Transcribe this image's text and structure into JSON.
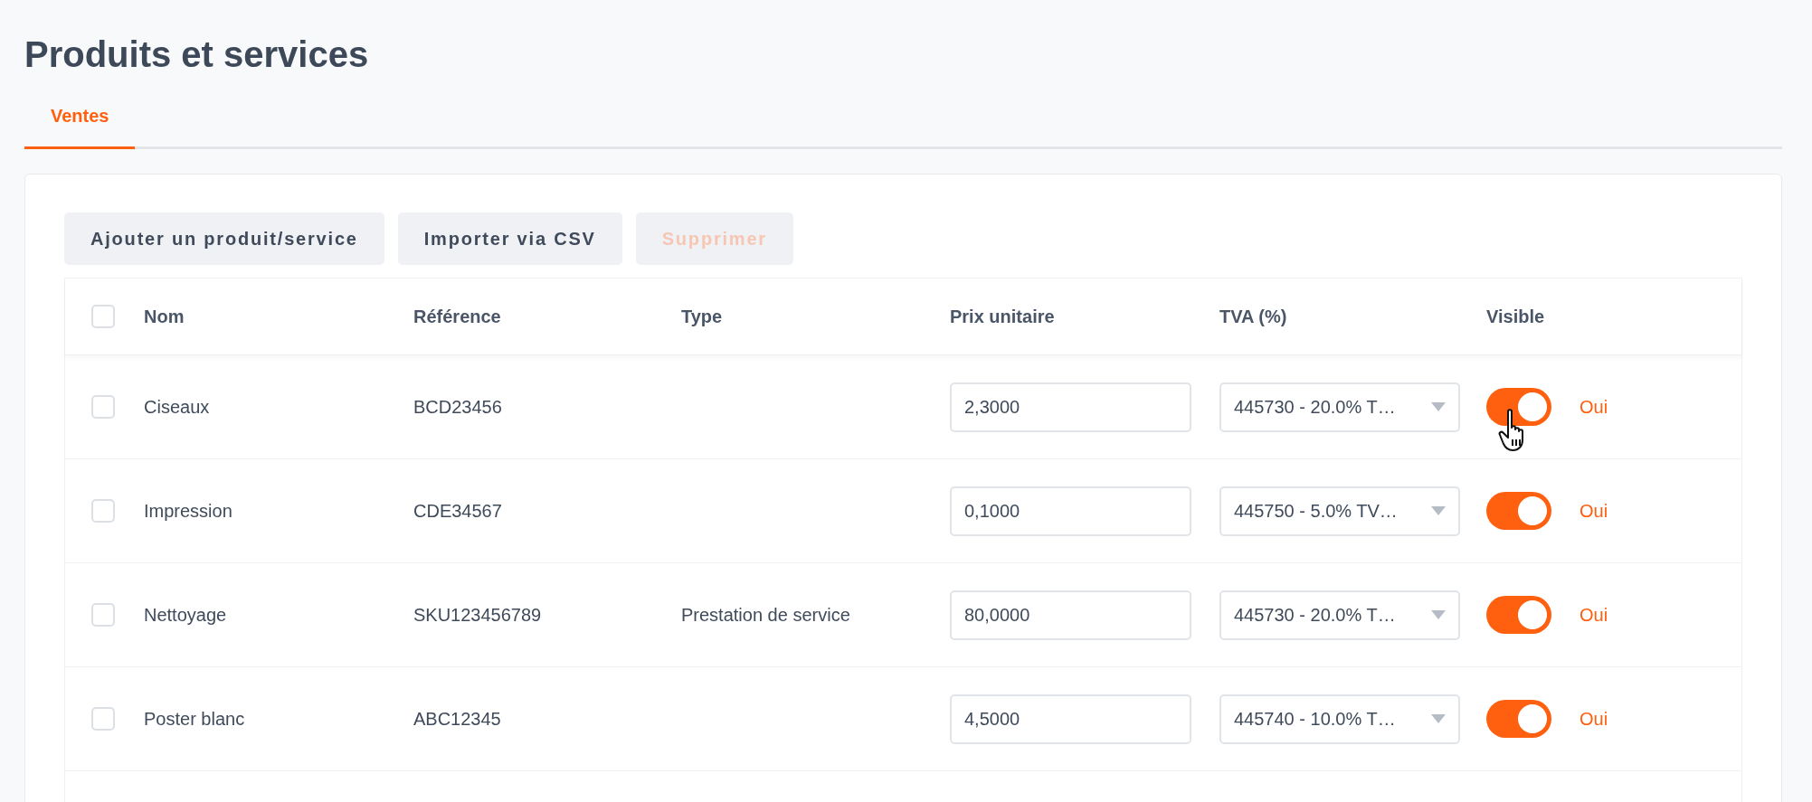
{
  "page": {
    "title": "Produits et services"
  },
  "tabs": [
    {
      "label": "Ventes",
      "selected": true
    }
  ],
  "toolbar": {
    "buttons": [
      {
        "label": "Ajouter un produit/service",
        "disabled": false
      },
      {
        "label": "Importer via CSV",
        "disabled": false
      },
      {
        "label": "Supprimer",
        "disabled": true
      }
    ]
  },
  "table": {
    "select_all": {
      "checked": false
    },
    "columns": [
      "Nom",
      "Référence",
      "Type",
      "Prix unitaire",
      "TVA (%)",
      "Visible"
    ],
    "rows": [
      {
        "checked": false,
        "name": "Ciseaux",
        "reference": "BCD23456",
        "type": "",
        "price": "2,3000",
        "vat": "445730 - 20.0% T…",
        "visible": true,
        "visible_label": "Oui",
        "hovered": true
      },
      {
        "checked": false,
        "name": "Impression",
        "reference": "CDE34567",
        "type": "",
        "price": "0,1000",
        "vat": "445750 - 5.0% TV…",
        "visible": true,
        "visible_label": "Oui",
        "hovered": false
      },
      {
        "checked": false,
        "name": "Nettoyage",
        "reference": "SKU123456789",
        "type": "Prestation de service",
        "price": "80,0000",
        "vat": "445730 - 20.0% T…",
        "visible": true,
        "visible_label": "Oui",
        "hovered": false
      },
      {
        "checked": false,
        "name": "Poster blanc",
        "reference": "ABC12345",
        "type": "",
        "price": "4,5000",
        "vat": "445740 - 10.0% T…",
        "visible": true,
        "visible_label": "Oui",
        "hovered": false
      }
    ],
    "partial_row": true
  }
}
